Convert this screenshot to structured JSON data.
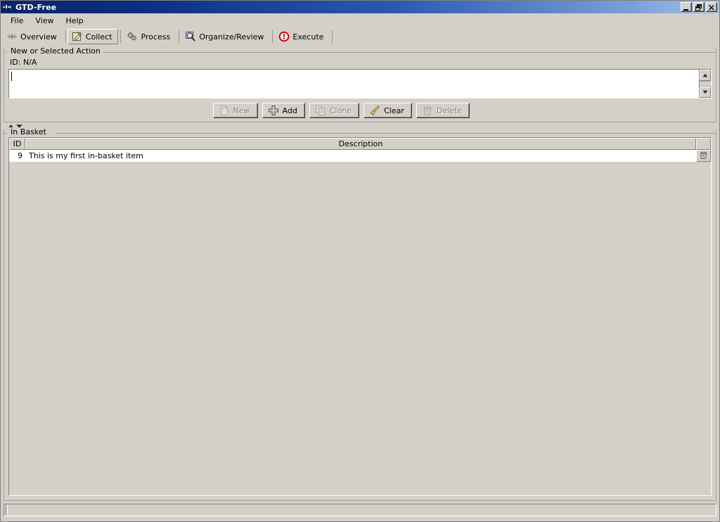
{
  "window": {
    "title": "GTD-Free",
    "icon": "app-icon",
    "buttons": {
      "minimize": "minimize",
      "restore": "restore",
      "close": "close"
    }
  },
  "menubar": {
    "items": [
      {
        "label": "File"
      },
      {
        "label": "View"
      },
      {
        "label": "Help"
      }
    ]
  },
  "tabs": {
    "items": [
      {
        "label": "Overview",
        "icon": "overview-icon",
        "selected": false
      },
      {
        "label": "Collect",
        "icon": "collect-note-icon",
        "selected": true
      },
      {
        "label": "Process",
        "icon": "process-gears-icon",
        "selected": false
      },
      {
        "label": "Organize/Review",
        "icon": "magnifier-icon",
        "selected": false
      },
      {
        "label": "Execute",
        "icon": "execute-alert-icon",
        "selected": false
      }
    ]
  },
  "action_panel": {
    "legend": "New or Selected Action",
    "id_label": "ID: N/A",
    "textarea": {
      "value": "",
      "placeholder": ""
    },
    "scrollbar": {
      "up": "scroll-up",
      "down": "scroll-down"
    },
    "buttons": [
      {
        "label": "New",
        "icon": "new-document-icon",
        "enabled": false
      },
      {
        "label": "Add",
        "icon": "plus-icon",
        "enabled": true
      },
      {
        "label": "Clone",
        "icon": "clone-copy-icon",
        "enabled": false
      },
      {
        "label": "Clear",
        "icon": "broom-icon",
        "enabled": true
      },
      {
        "label": "Delete",
        "icon": "trash-icon",
        "enabled": false
      }
    ]
  },
  "basket_panel": {
    "legend": "In Basket",
    "columns": [
      {
        "key": "id",
        "label": "ID"
      },
      {
        "key": "description",
        "label": "Description"
      },
      {
        "key": "action",
        "label": ""
      }
    ],
    "rows": [
      {
        "id": "9",
        "description": "This is my first in-basket item",
        "action_icon": "trash-icon"
      }
    ]
  },
  "statusbar": {
    "text": ""
  },
  "colors": {
    "face": "#d4d0c8",
    "title_start": "#0a246a",
    "title_end": "#a6c0e8",
    "field": "#ffffff",
    "disabled_text": "#808080",
    "accent_yellow": "#f2e07a",
    "accent_red": "#cc0000"
  }
}
